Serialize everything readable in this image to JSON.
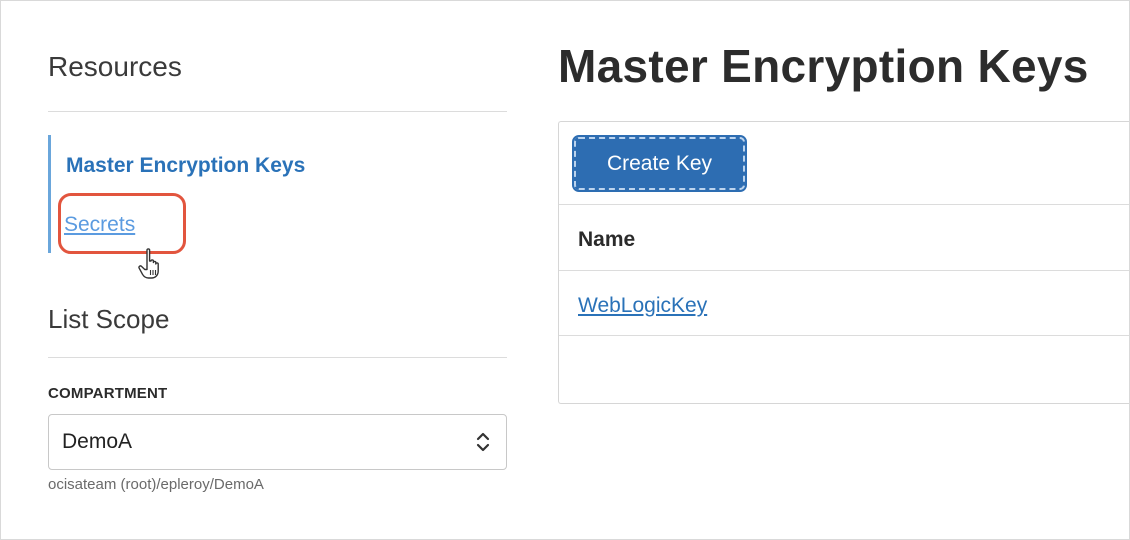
{
  "sidebar": {
    "resources_title": "Resources",
    "nav_items": [
      {
        "label": "Master Encryption Keys",
        "active": true
      },
      {
        "label": "Secrets",
        "active": false
      }
    ],
    "scope_title": "List Scope",
    "compartment_label": "COMPARTMENT",
    "compartment_value": "DemoA",
    "compartment_path": "ocisateam (root)/epleroy/DemoA"
  },
  "main": {
    "page_title": "Master Encryption Keys",
    "create_button_label": "Create Key",
    "table": {
      "columns": [
        "Name"
      ],
      "rows": [
        {
          "name": "WebLogicKey"
        }
      ]
    }
  },
  "colors": {
    "accent": "#2a72b8",
    "button_bg": "#2d6db2",
    "highlight": "#e2553e",
    "nav_marker": "#6aa6db"
  },
  "icons": {
    "cursor": "hand-pointer-icon",
    "select": "chevron-up-down-icon"
  }
}
